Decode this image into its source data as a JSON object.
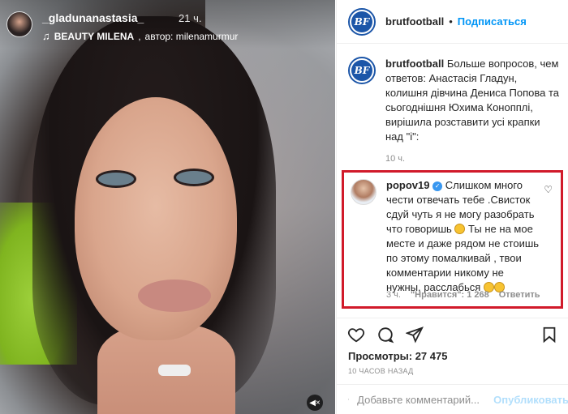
{
  "story": {
    "username": "_gladunanastasia_",
    "time": "21 ч.",
    "music_title": "BEAUTY MILENA",
    "music_sep": ",",
    "music_author": "автор: milenamurmur"
  },
  "post": {
    "username": "brutfootball",
    "dot": "•",
    "follow_label": "Подписаться",
    "caption_user": "brutfootball",
    "caption_text": "Больше вопросов, чем ответов: Анастасія Гладун, колишня дівчина Дениса Попова та сьогоднішня Юхима Конопплі, вирішила розставити усі крапки над \"і\":",
    "caption_time": "10 ч."
  },
  "comment": {
    "username": "popov19",
    "text_1": "Слишком много чести отвечать тебе .Свисток сдуй чуть я не могу разобрать что говоришь",
    "text_2": "Ты не на мое месте и даже рядом не стоишь по этому помалкивай , твои комментарии никому не нужны, расслабься",
    "time": "3 ч.",
    "likes": "\"Нравится\": 1 268",
    "reply_label": "Ответить"
  },
  "stats": {
    "likes": "Просмотры: 27 475",
    "posted": "10 ЧАСОВ НАЗАД"
  },
  "comment_box": {
    "placeholder": "Добавьте комментарий...",
    "publish_label": "Опубликовать"
  },
  "colors": {
    "accent": "#0095f6",
    "highlight": "#d11a2a",
    "brand": "#1c56a8"
  }
}
